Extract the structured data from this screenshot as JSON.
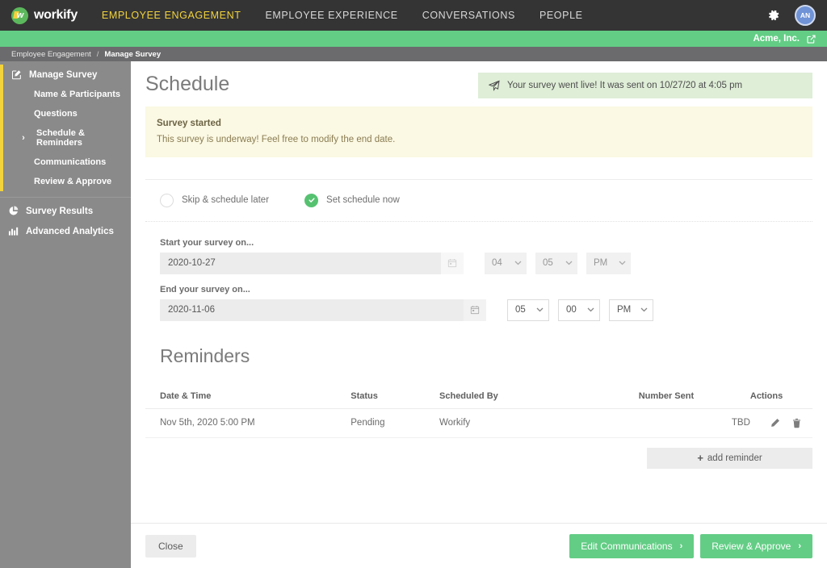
{
  "topnav": {
    "brand": "workify",
    "items": [
      {
        "label": "EMPLOYEE ENGAGEMENT",
        "active": true
      },
      {
        "label": "EMPLOYEE EXPERIENCE",
        "active": false
      },
      {
        "label": "CONVERSATIONS",
        "active": false
      },
      {
        "label": "PEOPLE",
        "active": false
      }
    ],
    "settings_icon": "gear-icon",
    "avatar_initials": "AN"
  },
  "orgbar": {
    "org_name": "Acme, Inc.",
    "external_icon": "external-link-icon"
  },
  "breadcrumb": {
    "root": "Employee Engagement",
    "separator": "/",
    "current": "Manage Survey"
  },
  "sidebar": {
    "group": {
      "header": {
        "label": "Manage Survey",
        "icon": "edit-square-icon"
      },
      "items": [
        {
          "label": "Name & Participants",
          "chevron": false
        },
        {
          "label": "Questions",
          "chevron": false
        },
        {
          "label": "Schedule & Reminders",
          "chevron": true
        },
        {
          "label": "Communications",
          "chevron": false
        },
        {
          "label": "Review & Approve",
          "chevron": false
        }
      ]
    },
    "bottom": [
      {
        "label": "Survey Results",
        "icon": "pie-chart-icon"
      },
      {
        "label": "Advanced Analytics",
        "icon": "bar-chart-icon"
      }
    ]
  },
  "main": {
    "page_title": "Schedule",
    "toast": {
      "icon": "paper-plane-icon",
      "text": "Your survey went live! It was sent on 10/27/20 at 4:05 pm"
    },
    "alert": {
      "title": "Survey started",
      "body": "This survey is underway! Feel free to modify the end date."
    },
    "schedule_options": [
      {
        "label": "Skip & schedule later",
        "selected": false
      },
      {
        "label": "Set schedule now",
        "selected": true
      }
    ],
    "start": {
      "label": "Start your survey on...",
      "date": "2020-10-27",
      "calendar_icon": "calendar-icon",
      "hour": "04",
      "minute": "05",
      "meridiem": "PM",
      "disabled": true
    },
    "end": {
      "label": "End your survey on...",
      "date": "2020-11-06",
      "calendar_icon": "calendar-icon",
      "hour": "05",
      "minute": "00",
      "meridiem": "PM",
      "disabled": false
    },
    "reminders": {
      "section_title": "Reminders",
      "columns": [
        "Date & Time",
        "Status",
        "Scheduled By",
        "Number Sent",
        "Actions"
      ],
      "rows": [
        {
          "datetime": "Nov 5th, 2020 5:00 PM",
          "status": "Pending",
          "scheduled_by": "Workify",
          "number_sent": "TBD",
          "edit_icon": "pencil-icon",
          "delete_icon": "trash-icon"
        }
      ],
      "add_label": "add reminder",
      "add_plus": "+"
    }
  },
  "footer": {
    "close_label": "Close",
    "edit_communications_label": "Edit Communications",
    "review_approve_label": "Review & Approve",
    "arrow": "›"
  },
  "colors": {
    "brand_green": "#63cd85",
    "accent_yellow": "#f2d33c",
    "topnav_dark": "#343434",
    "sidebar_gray": "#8a8a8a",
    "toast_green": "#dfeed7",
    "alert_cream": "#fbf8e3"
  }
}
